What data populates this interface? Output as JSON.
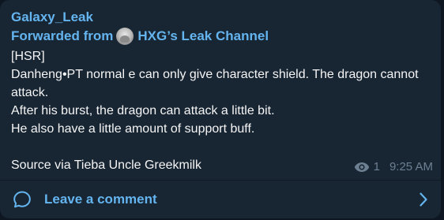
{
  "message": {
    "author": "Galaxy_Leak",
    "forwarded_prefix": "Forwarded from",
    "channel_name": "HXG’s Leak Channel",
    "lines": [
      "[HSR]",
      "Danheng•PT normal e can only give character shield. The dragon cannot attack.",
      "After his burst, the dragon can attack a little bit.",
      "He also have a little amount of support buff.",
      "",
      "Source via Tieba Uncle Greekmilk"
    ],
    "views": "1",
    "time": "9:25 AM",
    "comment_label": "Leave a comment"
  },
  "icons": {
    "views": "eye-icon",
    "comment": "chat-bubble-icon",
    "open": "chevron-right-icon",
    "channel": "channel-avatar"
  },
  "colors": {
    "background": "#0e1621",
    "bubble": "#182533",
    "accent": "#64b5ef",
    "text": "#f5f5f5",
    "meta": "#6d8092"
  }
}
